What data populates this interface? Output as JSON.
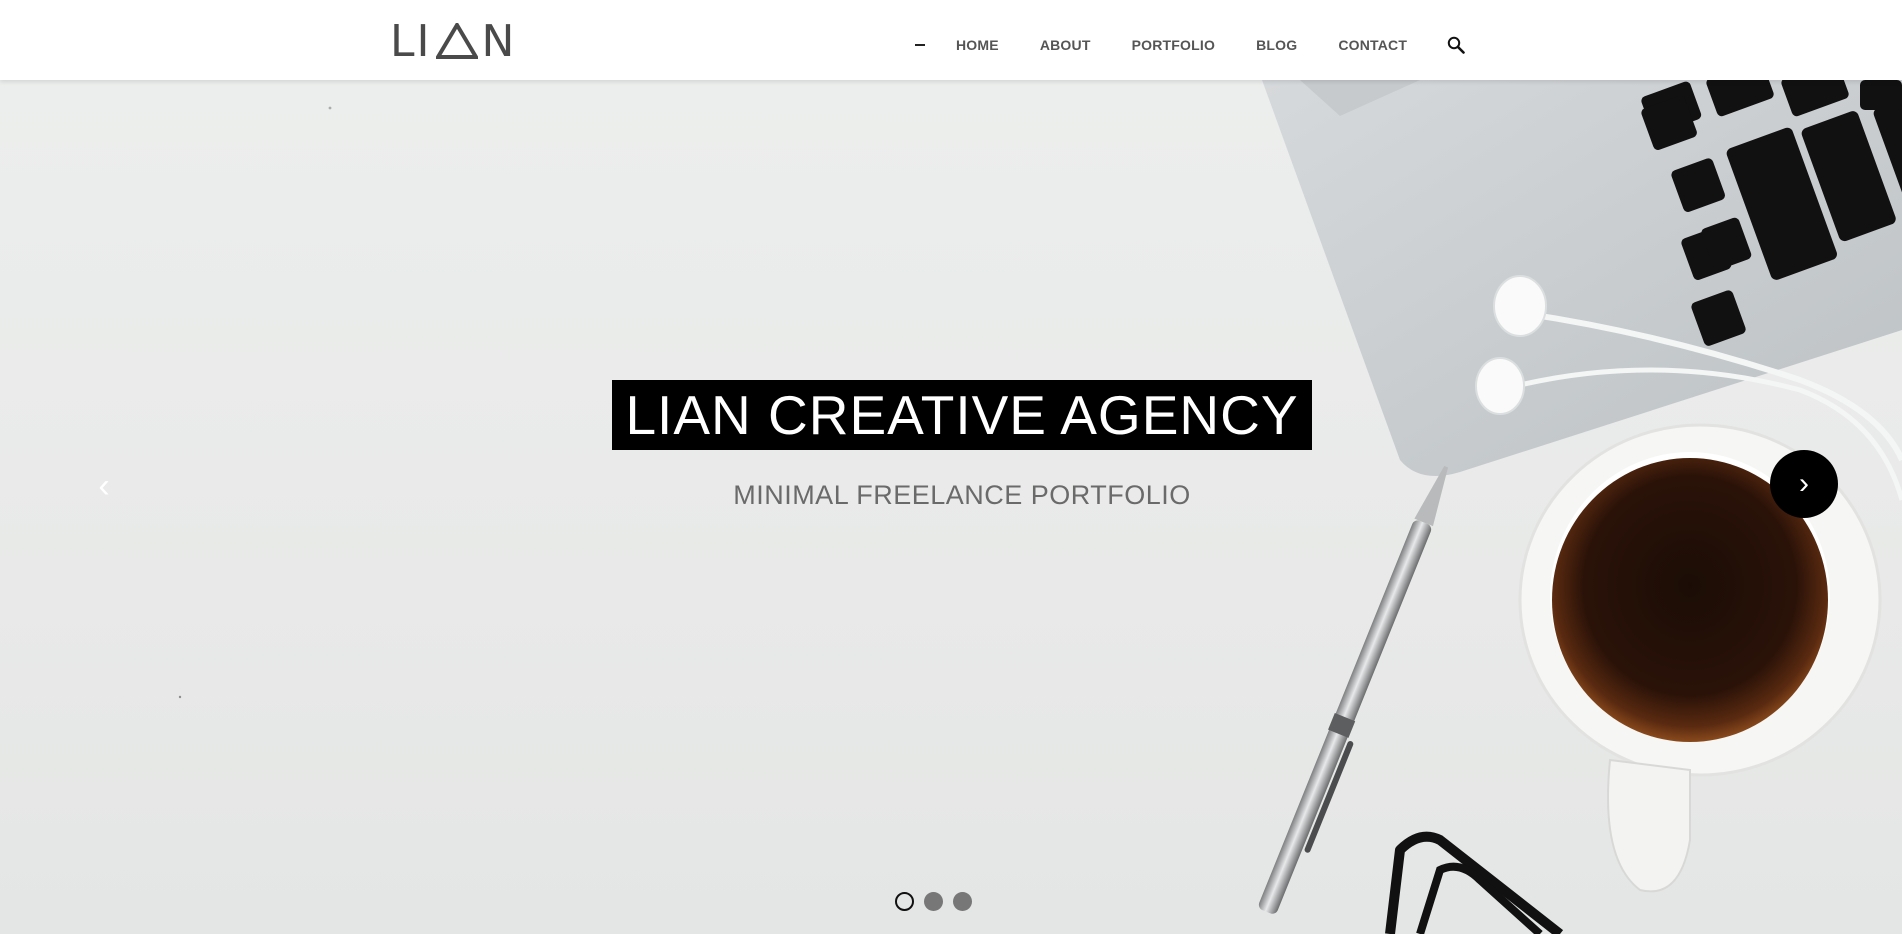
{
  "brand": {
    "logo_text_left": "LI",
    "logo_text_right": "N",
    "logo_alt": "LIAN"
  },
  "nav": {
    "items": [
      {
        "label": "HOME"
      },
      {
        "label": "ABOUT"
      },
      {
        "label": "PORTFOLIO"
      },
      {
        "label": "BLOG"
      },
      {
        "label": "CONTACT"
      }
    ],
    "search_icon": "search-icon",
    "menu_toggle_icon": "dash-icon"
  },
  "hero": {
    "title": "LIAN CREATIVE AGENCY",
    "subtitle": "MINIMAL FREELANCE PORTFOLIO",
    "prev_glyph": "‹",
    "next_glyph": "›",
    "slides_total": 3,
    "active_slide": 1
  },
  "colors": {
    "accent": "#000000",
    "nav_text": "#555555",
    "hero_bg": "#eceeed",
    "logo": "#4a4a4a"
  }
}
